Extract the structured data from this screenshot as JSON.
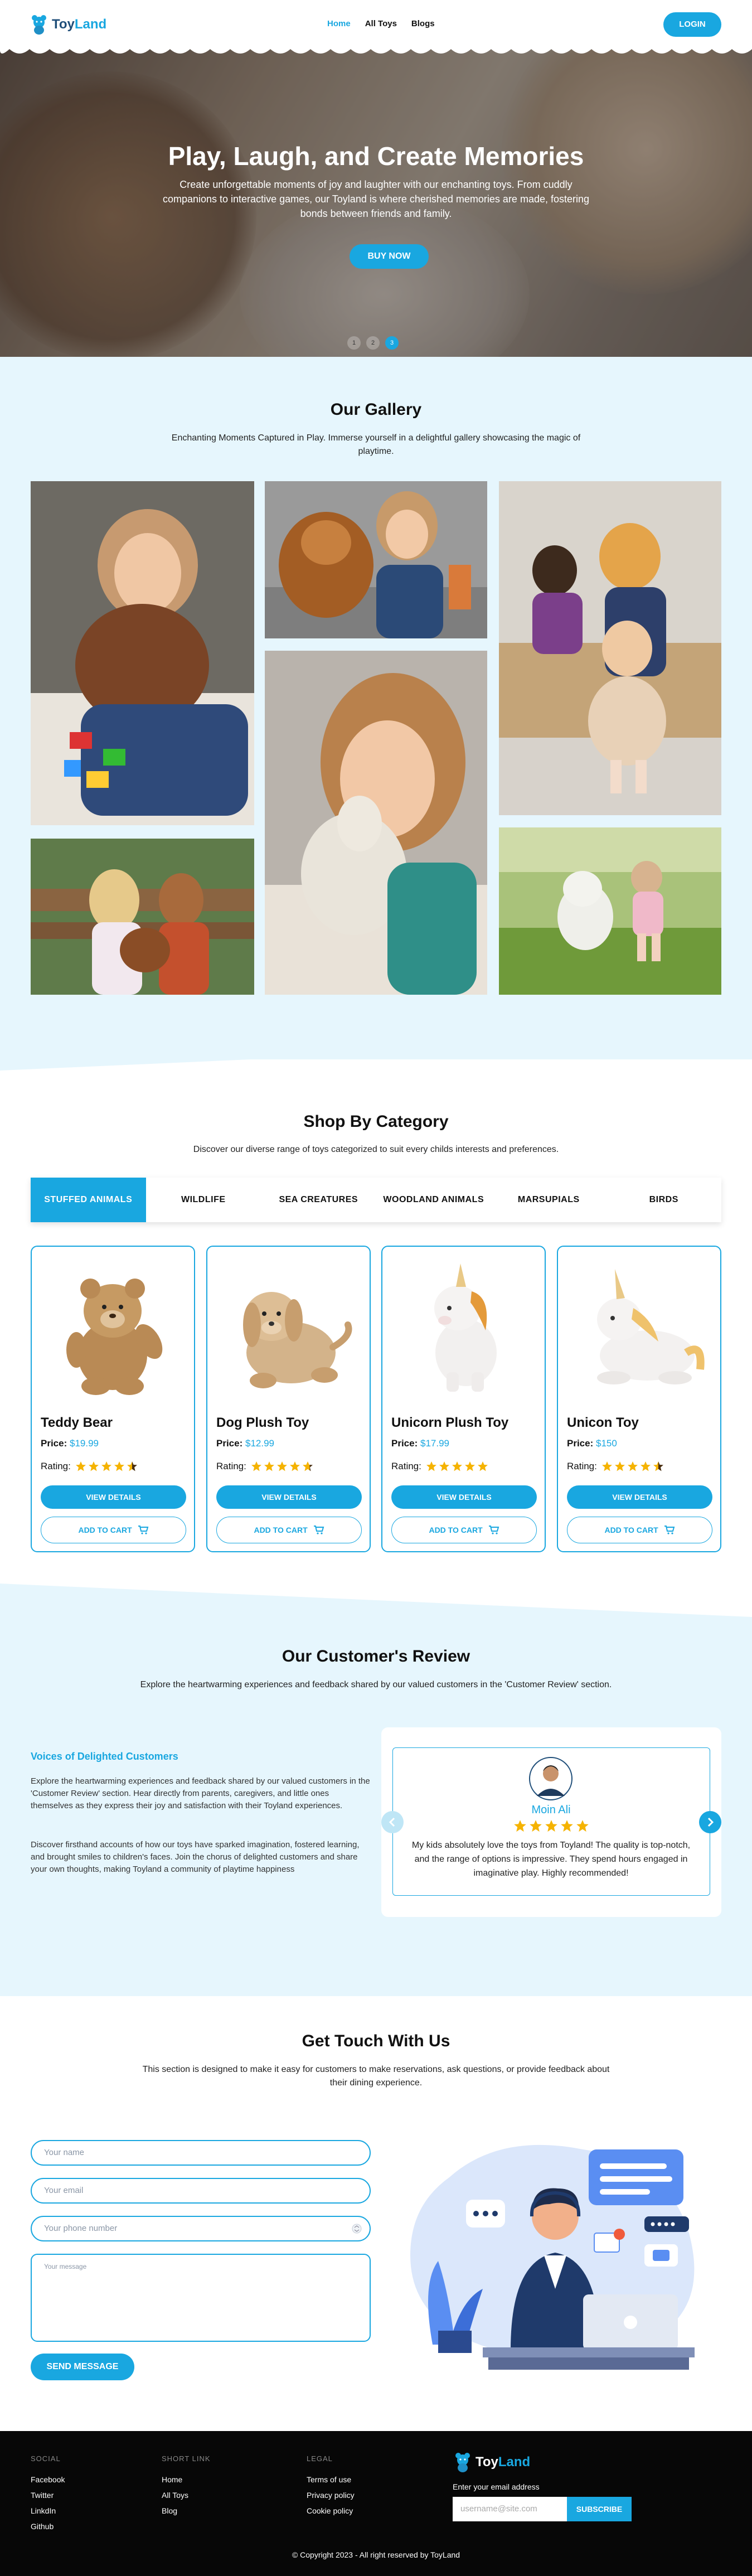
{
  "brand": {
    "name_part1": "Toy",
    "name_part2": "Land"
  },
  "nav": {
    "items": [
      {
        "label": "Home",
        "active": true
      },
      {
        "label": "All Toys",
        "active": false
      },
      {
        "label": "Blogs",
        "active": false
      }
    ],
    "login_label": "LOGIN"
  },
  "hero": {
    "title": "Play, Laugh, and Create Memories",
    "text": "Create unforgettable moments of joy and laughter with our enchanting toys. From cuddly companions to interactive games, our Toyland is where cherished memories are made, fostering bonds between friends and family.",
    "button_label": "BUY NOW",
    "dots": [
      "1",
      "2",
      "3"
    ],
    "active_dot": 2
  },
  "gallery": {
    "title": "Our Gallery",
    "subtitle": "Enchanting Moments Captured in Play. Immerse yourself in a delightful gallery showcasing the magic of playtime."
  },
  "category": {
    "title": "Shop By Category",
    "subtitle": "Discover our diverse range of toys categorized to suit every childs interests and preferences.",
    "tabs": [
      "STUFFED ANIMALS",
      "WILDLIFE",
      "SEA CREATURES",
      "WOODLAND ANIMALS",
      "MARSUPIALS",
      "BIRDS"
    ],
    "active_tab": 0,
    "price_label": "Price:",
    "rating_label": "Rating:",
    "details_label": "VIEW DETAILS",
    "cart_label": "ADD TO CART",
    "products": [
      {
        "name": "Teddy Bear",
        "price": "$19.99",
        "rating": 4.5,
        "toy": "teddy"
      },
      {
        "name": "Dog Plush Toy",
        "price": "$12.99",
        "rating": 4.7,
        "toy": "dog"
      },
      {
        "name": "Unicorn Plush Toy",
        "price": "$17.99",
        "rating": 5,
        "toy": "unicorn"
      },
      {
        "name": "Unicon Toy",
        "price": "$150",
        "rating": 4.5,
        "toy": "unicorn2"
      }
    ]
  },
  "review": {
    "title": "Our Customer's Review",
    "subtitle": "Explore the heartwarming experiences and feedback shared by our valued customers in the 'Customer Review' section.",
    "heading": "Voices of Delighted Customers",
    "para1": "Explore the heartwarming experiences and feedback shared by our valued customers in the 'Customer Review' section. Hear directly from parents, caregivers, and little ones themselves as they express their joy and satisfaction with their Toyland experiences.",
    "para2": "Discover firsthand accounts of how our toys have sparked imagination, fostered learning, and brought smiles to children's faces. Join the chorus of delighted customers and share your own thoughts, making Toyland a community of playtime happiness",
    "reviewer": "Moin Ali",
    "rating": 5,
    "quote": "My kids absolutely love the toys from Toyland! The quality is top-notch, and the range of options is impressive. They spend hours engaged in imaginative play. Highly recommended!"
  },
  "contact": {
    "title": "Get Touch With Us",
    "subtitle": "This section is designed to make it easy for customers to make reservations, ask questions, or provide feedback about their dining experience.",
    "name_placeholder": "Your name",
    "email_placeholder": "Your email",
    "phone_placeholder": "Your phone number",
    "message_placeholder": "Your message",
    "send_label": "SEND MESSAGE"
  },
  "footer": {
    "social_head": "SOCIAL",
    "social": [
      "Facebook",
      "Twitter",
      "LinkdIn",
      "Github"
    ],
    "short_head": "SHORT LINK",
    "short": [
      "Home",
      "All Toys",
      "Blog"
    ],
    "legal_head": "LEGAL",
    "legal": [
      "Terms of use",
      "Privacy policy",
      "Cookie policy"
    ],
    "email_label": "Enter your email address",
    "email_placeholder": "username@site.com",
    "subscribe_label": "SUBSCRIBE",
    "copyright": "© Copyright 2023 - All right reserved by ToyLand"
  },
  "colors": {
    "accent": "#19a7e0",
    "brand_dark": "#1f4e79",
    "light_bg": "#e6f6fd",
    "star": "#f5b301"
  }
}
